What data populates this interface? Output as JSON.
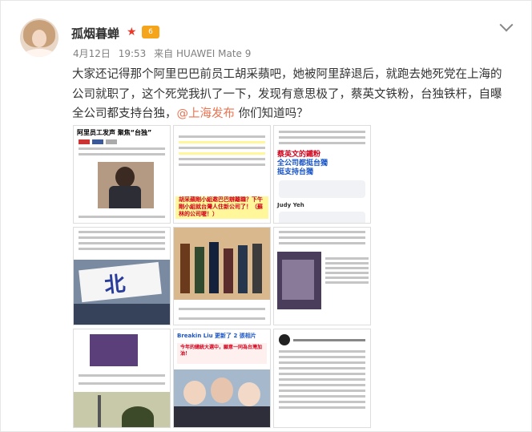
{
  "user": {
    "name": "孤烟暮蝉",
    "vip_symbol": "★",
    "badge_text": "6"
  },
  "meta": {
    "date": "4月12日",
    "time": "19:53",
    "source": "来自 HUAWEI Mate 9"
  },
  "post": {
    "text_before": "大家还记得那个阿里巴巴前员工胡采蘋吧，她被阿里辞退后，就跑去她死党在上海的公司就职了，这个死党我扒了一下，发现有意思极了，蔡英文铁粉，台独铁杆，自曝全公司都支持台独，",
    "mention": "@上海发布",
    "text_after": " 你们知道吗？"
  },
  "images": {
    "img1_headline": "阿里员工发声 聚焦“台独”",
    "img3_line1": "蔡英文的鐵粉",
    "img3_line2": "全公司都挺台獨",
    "img3_line3": "挺支持台獨",
    "img3_comment_name1": "Judy Yeh",
    "img2_highlight": "胡采蘋剛小組邀巴巴辦離職？下午剛小組就台灣人住新公司了！（蘇林的公司喔！）",
    "img4_banner": "北",
    "img8_header": "Breakin Liu 更新了 2 張相片",
    "img8_highlight": "今年的總統大選中，願意一同為台灣加油！"
  },
  "colors": {
    "accent": "#eb7350",
    "vip": "#e8392b",
    "badge": "#f4a51c"
  }
}
